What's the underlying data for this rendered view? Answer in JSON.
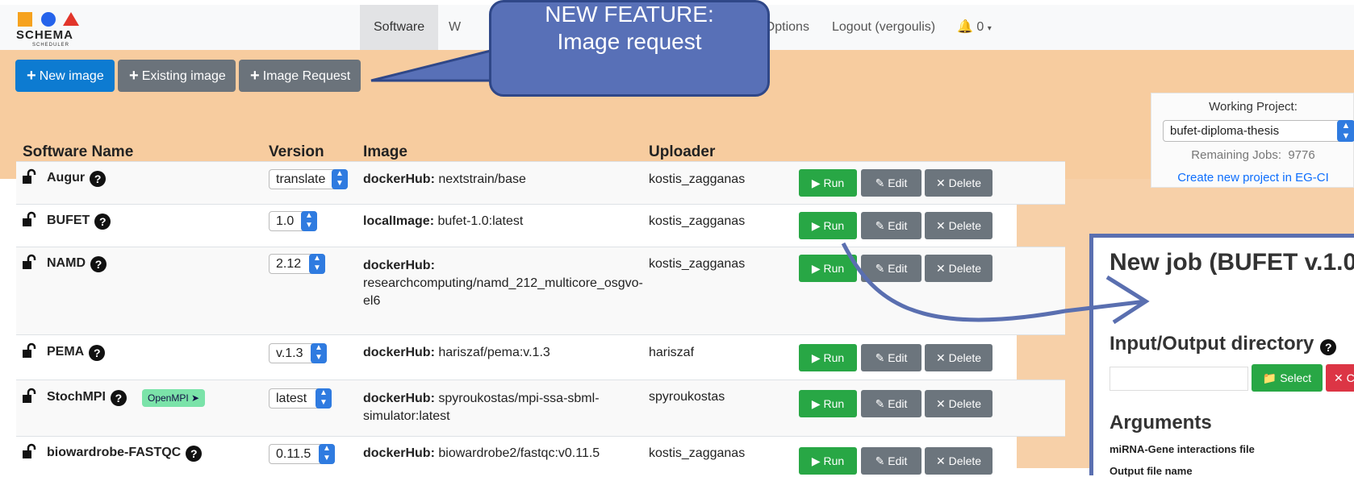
{
  "nav": {
    "logo_text": "SCHEMA",
    "logo_sub": "SCHEDULER",
    "software": "Software",
    "w_partial": "W",
    "admin": "Admin Options",
    "logout": "Logout (vergoulis)",
    "bell_count": "0"
  },
  "actions": {
    "new_image": "New image",
    "existing_image": "Existing image",
    "image_request": "Image Request"
  },
  "callout": {
    "line1": "NEW FEATURE:",
    "line2": "Image request"
  },
  "project": {
    "label": "Working Project:",
    "selected": "bufet-diploma-thesis",
    "remaining_label": "Remaining Jobs:",
    "remaining_value": "9776",
    "create_link": "Create new project in EG-CI"
  },
  "table": {
    "headers": [
      "Software Name",
      "Version",
      "Image",
      "Uploader"
    ],
    "rows": [
      {
        "name": "Augur",
        "version": "translate",
        "img_label": "dockerHub:",
        "img_value": "nextstrain/base",
        "uploader": "kostis_zagganas",
        "badge": ""
      },
      {
        "name": "BUFET",
        "version": "1.0",
        "img_label": "localImage:",
        "img_value": "bufet-1.0:latest",
        "uploader": "kostis_zagganas",
        "badge": ""
      },
      {
        "name": "NAMD",
        "version": "2.12",
        "img_label": "dockerHub:",
        "img_value": "researchcomputing/namd_212_multicore_osgvo-el6",
        "uploader": "kostis_zagganas",
        "badge": ""
      },
      {
        "name": "PEMA",
        "version": "v.1.3",
        "img_label": "dockerHub:",
        "img_value": "hariszaf/pema:v.1.3",
        "uploader": "hariszaf",
        "badge": ""
      },
      {
        "name": "StochMPI",
        "version": "latest",
        "img_label": "dockerHub:",
        "img_value": "spyroukostas/mpi-ssa-sbml-simulator:latest",
        "uploader": "spyroukostas",
        "badge": "OpenMPI"
      },
      {
        "name": "biowardrobe-FASTQC",
        "version": "0.11.5",
        "img_label": "dockerHub:",
        "img_value": "biowardrobe2/fastqc:v0.11.5",
        "uploader": "kostis_zagganas",
        "badge": ""
      }
    ],
    "run_label": "Run",
    "edit_label": "Edit",
    "delete_label": "Delete"
  },
  "job": {
    "title": "New job (BUFET v.1.0",
    "io_title": "Input/Output directory",
    "select_label": "Select",
    "clear_label": "C",
    "args_title": "Arguments",
    "arg1": "miRNA-Gene interactions file",
    "arg2": "Output file name"
  },
  "colors": {
    "primary": "#0d7bd1",
    "secondary": "#6b737b",
    "success": "#28a745",
    "danger": "#dc3545",
    "callout": "#5870b7",
    "background_band": "#f7cc9f"
  }
}
